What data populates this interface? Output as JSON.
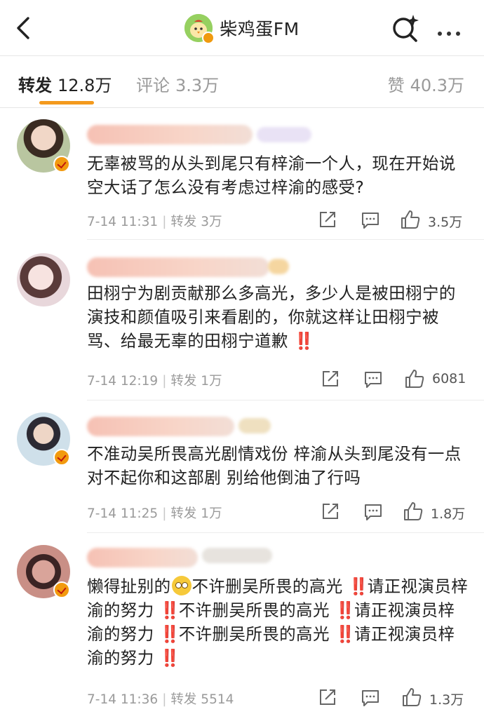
{
  "header": {
    "title": "柴鸡蛋FM"
  },
  "tabs": {
    "repost_label": "转发",
    "repost_count": "12.8万",
    "comment_label": "评论",
    "comment_count": "3.3万",
    "like_label": "赞",
    "like_count": "40.3万"
  },
  "colors": {
    "accent": "#f49a1d",
    "verified_badge": "#f29a0f",
    "alert_red": "#e0202a"
  },
  "items": [
    {
      "text": "无辜被骂的从头到尾只有梓渝一个人，现在开始说空大话了怎么没有考虑过梓渝的感受?",
      "time": "7-14 11:31",
      "repost": "转发 3万",
      "likes": "3.5万"
    },
    {
      "text_a": "田栩宁为剧贡献那么多高光，多少人是被田栩宁的演技和颜值吸引来看剧的，你就这样让田栩宁被骂、给最无辜的田栩宁道歉",
      "bang": "‼️",
      "time": "7-14 12:19",
      "repost": "转发 1万",
      "likes": "6081"
    },
    {
      "text": "不准动吴所畏高光剧情戏份 梓渝从头到尾没有一点对不起你和这部剧 别给他倒油了行吗",
      "time": "7-14 11:25",
      "repost": "转发 1万",
      "likes": "1.8万"
    },
    {
      "seg1": "懒得扯别的",
      "seg2": "不许删吴所畏的高光",
      "seg3": "请正视演员梓渝的努力",
      "seg4": "不许删吴所畏的高光",
      "seg5": "请正视演员梓渝的努力",
      "seg6": "不许删吴所畏的高光",
      "seg7": "请正视演员梓渝的努力",
      "bang": "‼️",
      "time": "7-14 11:36",
      "repost": "转发 5514",
      "likes": "1.3万"
    }
  ]
}
